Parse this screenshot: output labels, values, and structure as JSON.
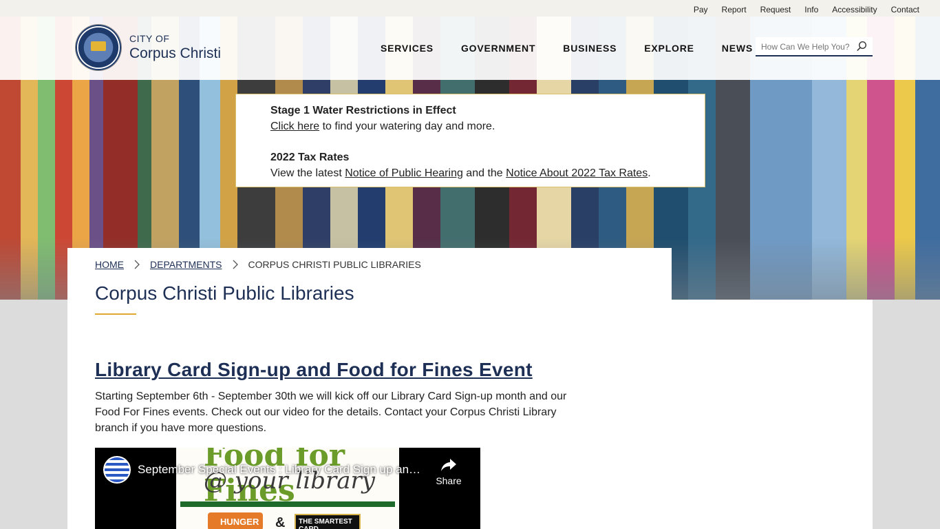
{
  "utility_nav": [
    "Pay",
    "Report",
    "Request",
    "Info",
    "Accessibility",
    "Contact"
  ],
  "brand": {
    "small": "CITY OF",
    "big": "Corpus Christi"
  },
  "main_nav": [
    "SERVICES",
    "GOVERNMENT",
    "BUSINESS",
    "EXPLORE",
    "NEWS"
  ],
  "search": {
    "placeholder": "How Can We Help You?"
  },
  "alert": {
    "water_title": "Stage 1 Water Restrictions in Effect",
    "water_link": "Click here",
    "water_text": " to find your watering day and more.",
    "tax_title": "2022 Tax Rates",
    "tax_prefix": "View the latest ",
    "tax_link1": "Notice of Public Hearing",
    "tax_mid": " and the ",
    "tax_link2": "Notice About 2022 Tax Rates",
    "tax_suffix": "."
  },
  "breadcrumb": {
    "home": "HOME",
    "departments": "DEPARTMENTS",
    "current": "CORPUS CHRISTI PUBLIC LIBRARIES"
  },
  "page_title": "Corpus Christi Public Libraries",
  "event": {
    "title": "Library Card Sign-up and Food for Fines Event ",
    "body": "Starting September 6th - September 30th we will kick off our Library Card Sign-up month and our Food For Fines events. Check out our video for the details. Contact your Corpus Christi Library branch if you have more questions."
  },
  "video": {
    "title": "September Special Events : Library Card Sign up and Food for Fines",
    "share_label": "Share",
    "thumb_line1": "Food for Fines",
    "thumb_line2": "@ your library",
    "thumb_hunger": "HUNGER",
    "thumb_amp": "&",
    "thumb_smart": "THE SMARTEST CARD"
  },
  "colors": {
    "navy": "#1d2f55",
    "gold": "#e0a82e",
    "alert_border": "#d9c06a"
  }
}
